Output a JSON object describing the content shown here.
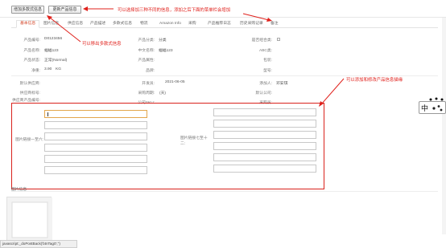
{
  "toolbar": {
    "btn_show": "增加多款式信息",
    "btn_hide": "更新产品信息"
  },
  "annotations": {
    "top": "可以选择加三种不同的信息，添加之后下面的菜单栏会增加",
    "left": "可以移出多款式信息",
    "right": "可以添加和修改产品信息描缘"
  },
  "tabs": [
    "基本信息",
    "图片信息",
    "供应信息",
    "产品描述",
    "多款式信息",
    "物流",
    "Amazon Info",
    "采购",
    "产品推荐日志",
    "历史采购记录",
    "备注"
  ],
  "form": {
    "product_code_label": "产品编号:",
    "product_code": "D0123456",
    "product_cat_label": "产品分类:",
    "product_cat": "分类",
    "recommend_label": "是否组合类:",
    "product_name_label": "产品名称:",
    "product_name": "蝠蝠123",
    "cn_name_label": "中文名称:",
    "cn_name": "蝠蝠123",
    "abc_label": "ABC类:",
    "product_status_label": "产品状态:",
    "product_status": "正常(Normal)",
    "product_attr_label": "产品属性:",
    "pack_label": "包装:",
    "weight_label": "净重:",
    "weight": "3.90",
    "weight_unit": "KG",
    "brand_label": "品牌:",
    "model_label": "型号:",
    "default_wh_label": "默认供应商:",
    "developer_label": "开发员:",
    "dev_date": "2021-06-05",
    "adder_label": "添加人:",
    "adder": "邓安琪",
    "supplier_no_label": "供应商标号:",
    "purchase_period_label": "采购周期:",
    "purchase_period": "(天)",
    "default_company_label": "默认公司:",
    "supplier_sku_label": "供应商产品编号:",
    "company_sku_label": "公司SKU:",
    "purchaser_label": "采购员:"
  },
  "section": {
    "img_label_left": "图片链接一至六:",
    "img_label_right": "图片链接七至十二:",
    "images_title": "图片信息"
  },
  "status_bar": "javascript:_doPostBack('btnTag0','')",
  "ime_char": "中"
}
